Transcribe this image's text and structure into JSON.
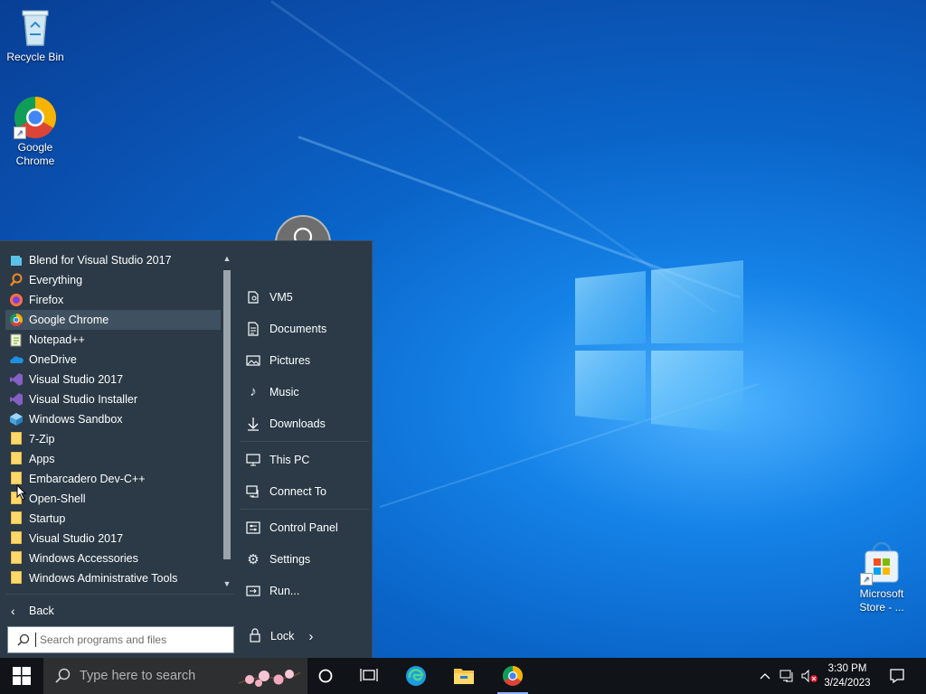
{
  "desktop": {
    "icons": [
      {
        "label": "Recycle Bin",
        "icon": "recycle-bin-icon"
      },
      {
        "label": "Google Chrome",
        "icon": "chrome-icon"
      },
      {
        "label": "Microsoft Store - ...",
        "icon": "store-icon"
      }
    ]
  },
  "start_menu": {
    "programs": [
      {
        "label": "Blend for Visual Studio 2017",
        "icon": "blend-icon",
        "color": "#5bc2e7"
      },
      {
        "label": "Everything",
        "icon": "everything-icon",
        "color": "#f08a24"
      },
      {
        "label": "Firefox",
        "icon": "firefox-icon",
        "color": "#ff7139"
      },
      {
        "label": "Google Chrome",
        "icon": "chrome-icon",
        "color": "#4285f4"
      },
      {
        "label": "Notepad++",
        "icon": "notepadpp-icon",
        "color": "#90c850"
      },
      {
        "label": "OneDrive",
        "icon": "onedrive-icon",
        "color": "#1e8fe1"
      },
      {
        "label": "Visual Studio 2017",
        "icon": "visual-studio-icon",
        "color": "#865fc5"
      },
      {
        "label": "Visual Studio Installer",
        "icon": "visual-studio-installer-icon",
        "color": "#865fc5"
      },
      {
        "label": "Windows Sandbox",
        "icon": "sandbox-icon",
        "color": "#4aa3df"
      },
      {
        "label": "7-Zip",
        "icon": "folder-icon"
      },
      {
        "label": "Apps",
        "icon": "folder-icon"
      },
      {
        "label": "Embarcadero Dev-C++",
        "icon": "folder-icon"
      },
      {
        "label": "Open-Shell",
        "icon": "folder-icon"
      },
      {
        "label": "Startup",
        "icon": "folder-icon"
      },
      {
        "label": "Visual Studio 2017",
        "icon": "folder-icon"
      },
      {
        "label": "Windows Accessories",
        "icon": "folder-icon"
      },
      {
        "label": "Windows Administrative Tools",
        "icon": "folder-icon"
      }
    ],
    "back_label": "Back",
    "search_placeholder": "Search programs and files",
    "right_items": [
      {
        "label": "VM5",
        "icon": "user-folder-icon"
      },
      {
        "label": "Documents",
        "icon": "documents-icon"
      },
      {
        "label": "Pictures",
        "icon": "pictures-icon"
      },
      {
        "label": "Music",
        "icon": "music-icon"
      },
      {
        "label": "Downloads",
        "icon": "downloads-icon"
      },
      {
        "label": "This PC",
        "icon": "this-pc-icon"
      },
      {
        "label": "Connect To",
        "icon": "connect-to-icon"
      },
      {
        "label": "Control Panel",
        "icon": "control-panel-icon"
      },
      {
        "label": "Settings",
        "icon": "settings-icon"
      },
      {
        "label": "Run...",
        "icon": "run-icon"
      }
    ],
    "lock_label": "Lock"
  },
  "taskbar": {
    "search_placeholder": "Type here to search",
    "time": "3:30 PM",
    "date": "3/24/2023"
  }
}
